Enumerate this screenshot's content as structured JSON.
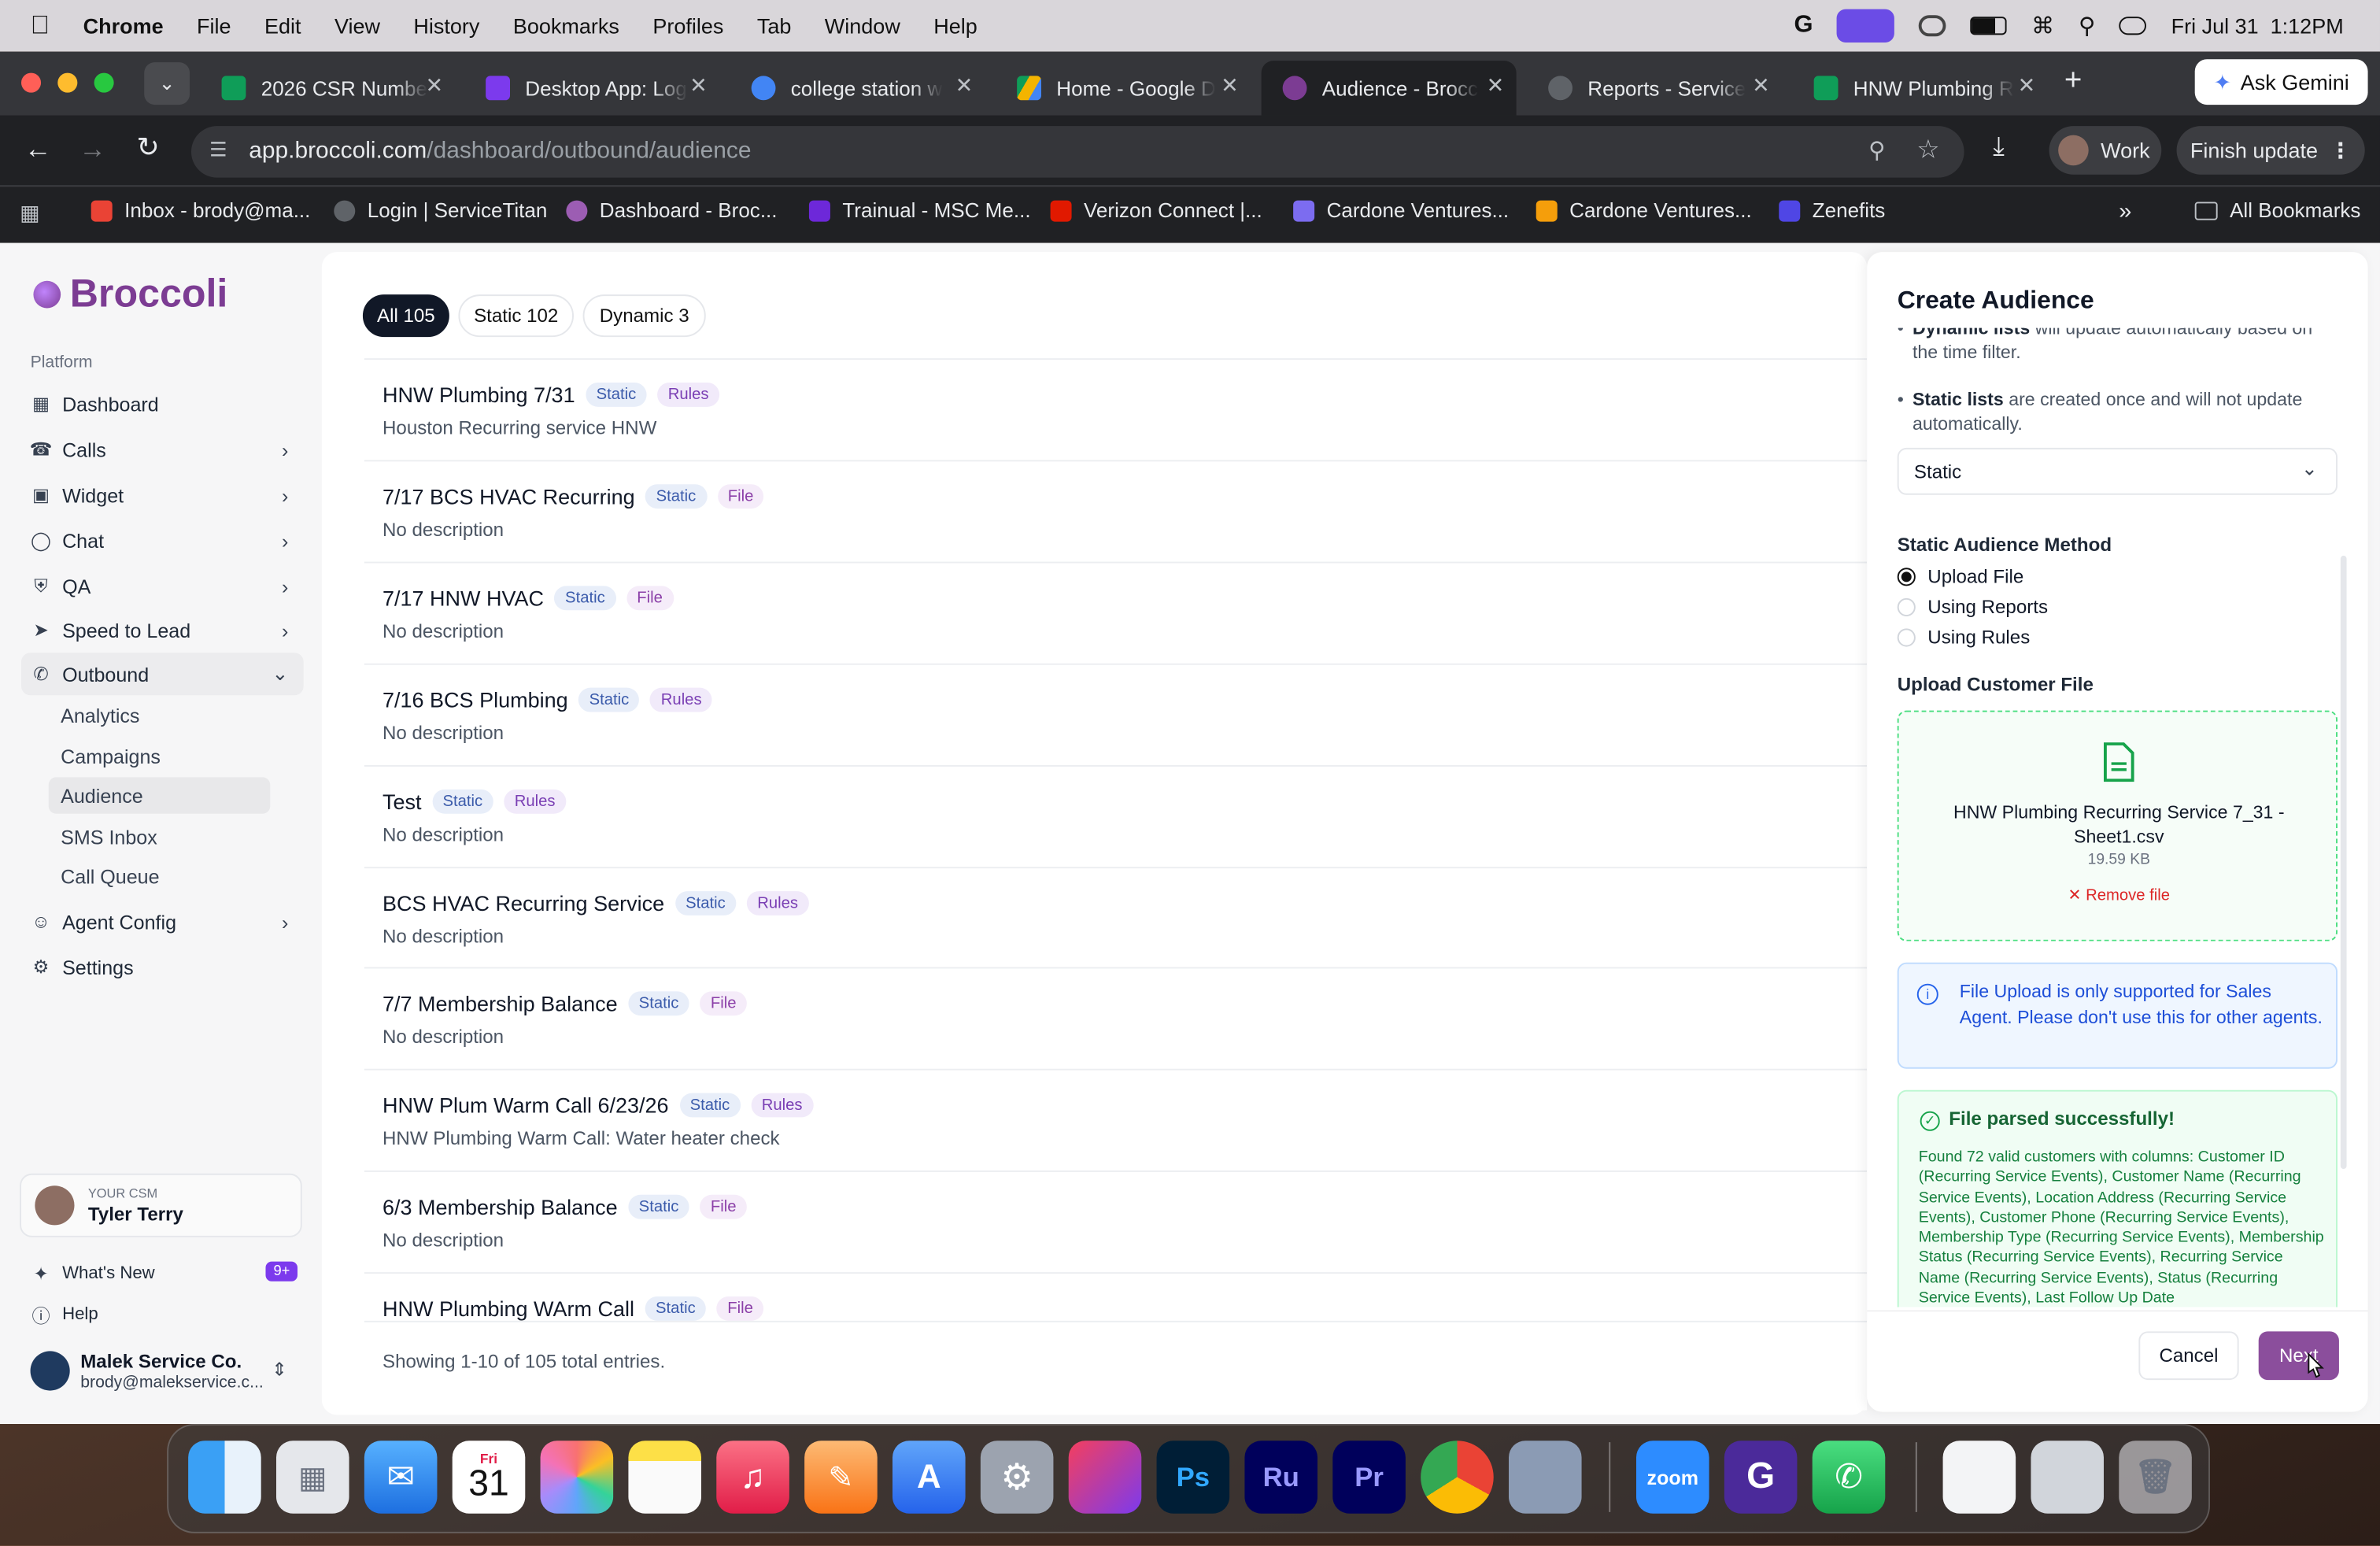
{
  "menubar": {
    "app": "Chrome",
    "items": [
      "File",
      "Edit",
      "View",
      "History",
      "Bookmarks",
      "Profiles",
      "Tab",
      "Window",
      "Help"
    ],
    "datetime": "Fri Jul 31  1:12PM"
  },
  "tabs": [
    {
      "title": "2026 CSR Numbe",
      "color": "#0f9d58"
    },
    {
      "title": "Desktop App: Log",
      "color": "#7c3aed"
    },
    {
      "title": "college station w",
      "color": "#4285f4"
    },
    {
      "title": "Home - Google D",
      "color": "#f4b400"
    },
    {
      "title": "Audience - Brocc",
      "color": "#7c3c93"
    },
    {
      "title": "Reports - Service",
      "color": "#9aa0a6"
    },
    {
      "title": "HNW Plumbing R",
      "color": "#0f9d58"
    }
  ],
  "toolbar": {
    "url_host": "app.broccoli.com",
    "url_path": "/dashboard/outbound/audience",
    "ask_gemini": "Ask Gemini",
    "profile": "Work",
    "finish_update": "Finish update"
  },
  "bookmarks": [
    "Inbox - brody@ma...",
    "Login | ServiceTitan",
    "Dashboard - Broc...",
    "Trainual - MSC Me...",
    "Verizon Connect |...",
    "Cardone Ventures...",
    "Cardone Ventures...",
    "Zenefits"
  ],
  "all_bookmarks": "All Bookmarks",
  "sidebar": {
    "logo": "Broccoli",
    "section": "Platform",
    "nav": {
      "dashboard": "Dashboard",
      "calls": "Calls",
      "widget": "Widget",
      "chat": "Chat",
      "qa": "QA",
      "speed": "Speed to Lead",
      "outbound": "Outbound",
      "agent": "Agent Config",
      "settings": "Settings"
    },
    "outbound_sub": [
      "Analytics",
      "Campaigns",
      "Audience",
      "SMS Inbox",
      "Call Queue"
    ],
    "csm_label": "YOUR CSM",
    "csm_name": "Tyler Terry",
    "whats_new": "What's New",
    "whats_new_badge": "9+",
    "help": "Help",
    "org_name": "Malek Service Co.",
    "org_email": "brody@malekservice.c..."
  },
  "filters": {
    "all": "All 105",
    "static": "Static 102",
    "dynamic": "Dynamic 3"
  },
  "audiences": [
    {
      "name": "HNW Plumbing 7/31",
      "type": "Static",
      "source": "Rules",
      "desc": "Houston Recurring service HNW"
    },
    {
      "name": "7/17 BCS HVAC Recurring",
      "type": "Static",
      "source": "File",
      "desc": "No description"
    },
    {
      "name": "7/17 HNW HVAC",
      "type": "Static",
      "source": "File",
      "desc": "No description"
    },
    {
      "name": "7/16 BCS Plumbing",
      "type": "Static",
      "source": "Rules",
      "desc": "No description"
    },
    {
      "name": "Test",
      "type": "Static",
      "source": "Rules",
      "desc": "No description"
    },
    {
      "name": "BCS HVAC Recurring Service",
      "type": "Static",
      "source": "Rules",
      "desc": "No description"
    },
    {
      "name": "7/7 Membership Balance",
      "type": "Static",
      "source": "File",
      "desc": "No description"
    },
    {
      "name": "HNW Plum Warm Call 6/23/26",
      "type": "Static",
      "source": "Rules",
      "desc": "HNW Plumbing Warm Call: Water heater check"
    },
    {
      "name": "6/3 Membership Balance",
      "type": "Static",
      "source": "File",
      "desc": "No description"
    },
    {
      "name": "HNW Plumbing WArm Call",
      "type": "Static",
      "source": "File",
      "desc": ""
    }
  ],
  "footer": "Showing 1-10 of 105 total entries.",
  "panel": {
    "title": "Create Audience",
    "dyn_bold": "Dynamic lists",
    "dyn_text": " will update automatically based on the time filter.",
    "static_bold": "Static lists",
    "static_text": " are created once and will not update automatically.",
    "list_type": "Static",
    "method_label": "Static Audience Method",
    "methods": [
      "Upload File",
      "Using Reports",
      "Using Rules"
    ],
    "upload_label": "Upload Customer File",
    "file_name": "HNW Plumbing Recurring Service 7_31 - Sheet1.csv",
    "file_size": "19.59 KB",
    "remove": "Remove file",
    "info": "File Upload is only supported for Sales Agent. Please don't use this for other agents.",
    "success_title": "File parsed successfully!",
    "success_prefix": "Found 72 valid customers with columns: ",
    "success_cols": "Customer ID (Recurring Service Events), Customer Name (Recurring Service Events), Location Address (Recurring Service Events), Customer Phone (Recurring Service Events), Membership Type (Recurring Service Events), Membership Status (Recurring Service Events), Recurring Service Name (Recurring Service Events), Status (Recurring Service Events), Last Follow Up Date",
    "cancel": "Cancel",
    "next": "Next"
  },
  "dock": {
    "calendar_month": "Fri",
    "calendar_day": "31"
  }
}
